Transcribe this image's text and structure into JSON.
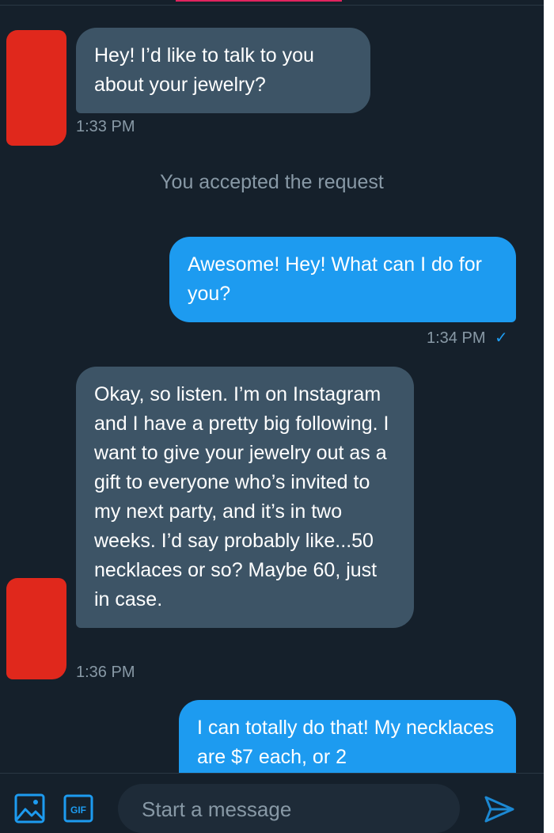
{
  "conversation": {
    "messages": [
      {
        "direction": "in",
        "text": "Hey! I’d like to talk to you about your jewelry?",
        "time": "1:33 PM"
      },
      {
        "direction": "out",
        "text": "Awesome! Hey! What can I do for you?",
        "time": "1:34 PM",
        "read": true
      },
      {
        "direction": "in",
        "text": "Okay, so listen. I’m on Instagram and I have a pretty big following. I want to give your jewelry out as a gift to everyone who’s invited to my next party, and it’s in two weeks. I’d say probably like...50 necklaces or so? Maybe 60, just in case.",
        "time": "1:36 PM"
      },
      {
        "direction": "out",
        "text": "I can totally do that! My necklaces are $7 each, or 2"
      }
    ],
    "system_notice": "You accepted the request",
    "read_check": "✓"
  },
  "composer": {
    "placeholder": "Start a message",
    "gif_label": "GIF",
    "icons": [
      "image-icon",
      "gif-icon",
      "send-icon"
    ]
  },
  "colors": {
    "background": "#15202b",
    "incoming_bubble": "#3d5466",
    "outgoing_bubble": "#1d9bf0",
    "muted_text": "#8899a6",
    "avatar_redaction": "#e0281c"
  }
}
